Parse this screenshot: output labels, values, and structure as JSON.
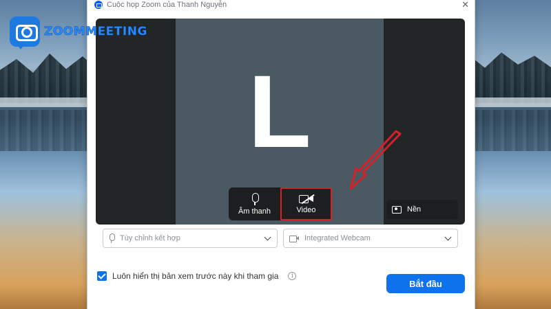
{
  "brand": {
    "text": "ZOOMMEETING",
    "logo_icon": "zoom-camera-bubble-icon"
  },
  "window": {
    "title": "Cuộc họp Zoom của Thanh Nguyễn",
    "close_icon": "close-icon"
  },
  "preview": {
    "avatar_letter": "L"
  },
  "controls": {
    "audio": {
      "label": "Âm thanh",
      "icon": "microphone-icon"
    },
    "video": {
      "label": "Video",
      "icon": "video-off-icon",
      "highlight_color": "#d6202a"
    },
    "background": {
      "label": "Nền",
      "icon": "background-icon"
    }
  },
  "dropdowns": {
    "microphone": {
      "value": "Tùy chỉnh kết hợp",
      "icon": "microphone-icon"
    },
    "camera": {
      "value": "Integrated Webcam",
      "icon": "camera-icon"
    }
  },
  "footer": {
    "always_show_preview_label": "Luôn hiển thị bản xem trước này khi tham gia",
    "always_show_preview_checked": true,
    "info_icon_glyph": "i",
    "start_button_label": "Bắt đầu"
  },
  "colors": {
    "accent": "#0e72ed",
    "annotation": "#d6202a",
    "avatar_bg": "#4b5a62"
  }
}
